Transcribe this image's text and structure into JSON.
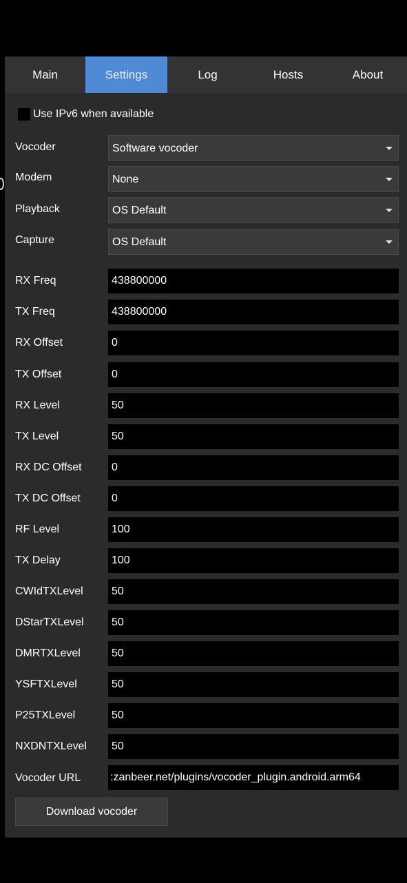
{
  "tabs": [
    "Main",
    "Settings",
    "Log",
    "Hosts",
    "About"
  ],
  "active_tab": "Settings",
  "ipv6": {
    "label": "Use IPv6 when available",
    "checked": false
  },
  "selects": [
    {
      "label": "Vocoder",
      "value": "Software vocoder"
    },
    {
      "label": "Modem",
      "value": "None"
    },
    {
      "label": "Playback",
      "value": "OS Default"
    },
    {
      "label": "Capture",
      "value": "OS Default"
    }
  ],
  "fields": [
    {
      "label": "RX Freq",
      "value": "438800000"
    },
    {
      "label": "TX Freq",
      "value": "438800000"
    },
    {
      "label": "RX Offset",
      "value": "0"
    },
    {
      "label": "TX Offset",
      "value": "0"
    },
    {
      "label": "RX Level",
      "value": "50"
    },
    {
      "label": "TX Level",
      "value": "50"
    },
    {
      "label": "RX DC Offset",
      "value": "0"
    },
    {
      "label": "TX DC Offset",
      "value": "0"
    },
    {
      "label": "RF Level",
      "value": "100"
    },
    {
      "label": "TX Delay",
      "value": "100"
    },
    {
      "label": "CWIdTXLevel",
      "value": "50"
    },
    {
      "label": "DStarTXLevel",
      "value": "50"
    },
    {
      "label": "DMRTXLevel",
      "value": "50"
    },
    {
      "label": "YSFTXLevel",
      "value": "50"
    },
    {
      "label": "P25TXLevel",
      "value": "50"
    },
    {
      "label": "NXDNTXLevel",
      "value": "50"
    }
  ],
  "vocoder_url": {
    "label": "Vocoder URL",
    "value": ":zanbeer.net/plugins/vocoder_plugin.android.arm64"
  },
  "download_button": "Download vocoder",
  "colors": {
    "background": "#2b2b2b",
    "tab_active": "#4e8ad6",
    "field_bg": "#000000",
    "combo_bg": "#3a3a3a"
  }
}
